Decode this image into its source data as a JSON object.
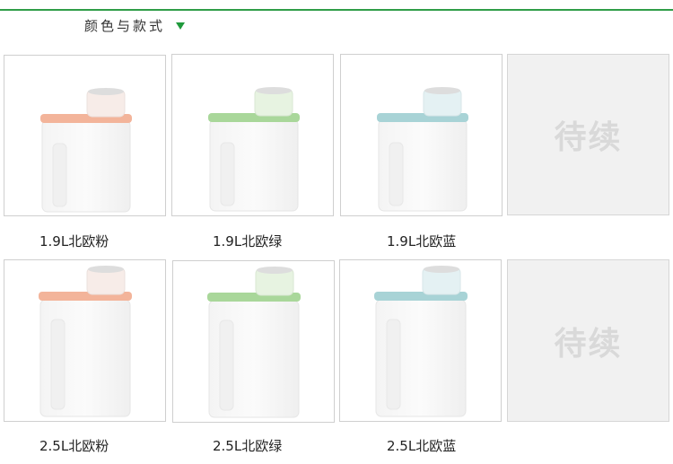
{
  "header": {
    "title": "颜色与款式",
    "dropdown_icon": "triangle-down-icon"
  },
  "colors": {
    "rule": "#2f9d48",
    "arrow": "#1f9a3c",
    "pink_lid": "#f3b49a",
    "green_lid": "#a9d79a",
    "blue_lid": "#a8d3d6"
  },
  "products": [
    {
      "label": "1.9L北欧粉",
      "lid_color": "pink"
    },
    {
      "label": "1.9L北欧绿",
      "lid_color": "green"
    },
    {
      "label": "1.9L北欧蓝",
      "lid_color": "blue"
    },
    {
      "placeholder": "待续"
    },
    {
      "label": "2.5L北欧粉",
      "lid_color": "pink"
    },
    {
      "label": "2.5L北欧绿",
      "lid_color": "green"
    },
    {
      "label": "2.5L北欧蓝",
      "lid_color": "blue"
    },
    {
      "placeholder": "待续"
    }
  ]
}
